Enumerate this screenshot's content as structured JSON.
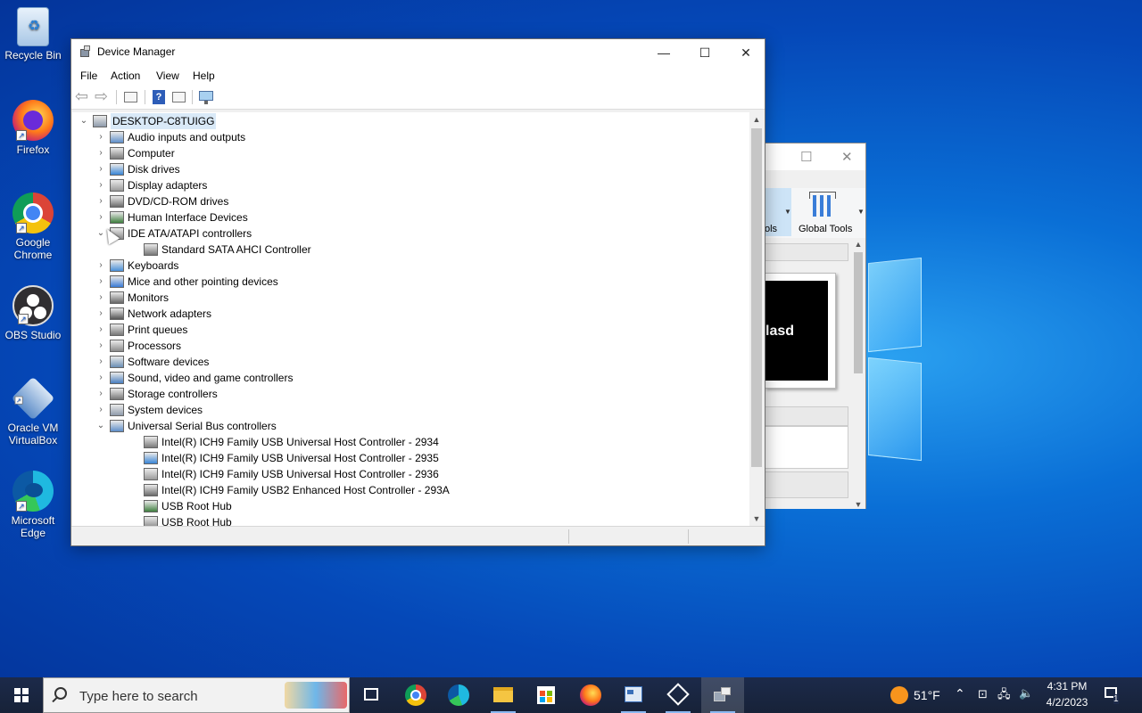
{
  "desktop": {
    "icons": [
      {
        "label": "Recycle Bin"
      },
      {
        "label": "Firefox"
      },
      {
        "label": "Google Chrome"
      },
      {
        "label": "OBS Studio"
      },
      {
        "label": "Oracle VM VirtualBox"
      },
      {
        "label": "Microsoft Edge"
      }
    ]
  },
  "background_window": {
    "tab_partial": "ols",
    "global_tools_label": "Global Tools",
    "preview_text": "lasd"
  },
  "device_manager": {
    "title": "Device Manager",
    "menu": [
      "File",
      "Action",
      "View",
      "Help"
    ],
    "root": "DESKTOP-C8TUIGG",
    "categories": [
      {
        "label": "Audio inputs and outputs",
        "expanded": false
      },
      {
        "label": "Computer",
        "expanded": false
      },
      {
        "label": "Disk drives",
        "expanded": false
      },
      {
        "label": "Display adapters",
        "expanded": false
      },
      {
        "label": "DVD/CD-ROM drives",
        "expanded": false
      },
      {
        "label": "Human Interface Devices",
        "expanded": false
      },
      {
        "label": "IDE ATA/ATAPI controllers",
        "expanded": true,
        "children": [
          "Standard SATA AHCI Controller"
        ]
      },
      {
        "label": "Keyboards",
        "expanded": false
      },
      {
        "label": "Mice and other pointing devices",
        "expanded": false
      },
      {
        "label": "Monitors",
        "expanded": false
      },
      {
        "label": "Network adapters",
        "expanded": false
      },
      {
        "label": "Print queues",
        "expanded": false
      },
      {
        "label": "Processors",
        "expanded": false
      },
      {
        "label": "Software devices",
        "expanded": false
      },
      {
        "label": "Sound, video and game controllers",
        "expanded": false
      },
      {
        "label": "Storage controllers",
        "expanded": false
      },
      {
        "label": "System devices",
        "expanded": false
      },
      {
        "label": "Universal Serial Bus controllers",
        "expanded": true,
        "children": [
          "Intel(R) ICH9 Family USB Universal Host Controller - 2934",
          "Intel(R) ICH9 Family USB Universal Host Controller - 2935",
          "Intel(R) ICH9 Family USB Universal Host Controller - 2936",
          "Intel(R) ICH9 Family USB2 Enhanced Host Controller - 293A",
          "USB Root Hub",
          "USB Root Hub"
        ]
      }
    ]
  },
  "taskbar": {
    "search_placeholder": "Type here to search",
    "weather": "51°F",
    "time": "4:31 PM",
    "date": "4/2/2023",
    "notification_count": "1",
    "apps": [
      "task-view",
      "chrome",
      "edge",
      "file-explorer",
      "microsoft-store",
      "firefox",
      "control-panel",
      "virtualbox",
      "device-manager"
    ]
  },
  "colors": {
    "selection": "#d9e9f7",
    "taskbar": "#1c2a4a",
    "desktop": "#0a6fd6"
  }
}
